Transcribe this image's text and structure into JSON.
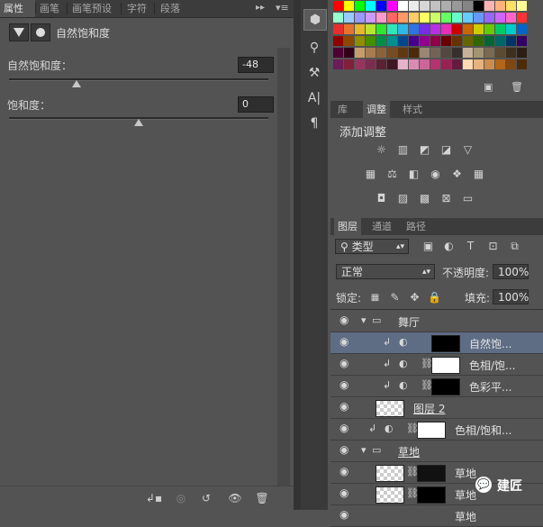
{
  "properties_panel": {
    "tabs": [
      "属性",
      "画笔",
      "画笔预设",
      "字符",
      "段落"
    ],
    "title": "自然饱和度",
    "vibrance_label": "自然饱和度：",
    "vibrance_value": "-48",
    "vibrance_fraction": 0.26,
    "saturation_label": "饱和度：",
    "saturation_value": "0",
    "saturation_fraction": 0.5
  },
  "swatches_colors": [
    [
      "#ff0000",
      "#ffff00",
      "#00ff00",
      "#00ffff",
      "#0000ff",
      "#ff00ff",
      "#ffffff",
      "#ebebeb",
      "#d6d6d6",
      "#c2c2c2",
      "#adadad",
      "#999999",
      "#858585",
      "#000000",
      "#ffb3b3",
      "#ffb37a",
      "#ffe066",
      "#ffff99"
    ],
    [
      "#99ffcc",
      "#99ccff",
      "#9999ff",
      "#cc99ff",
      "#ff99cc",
      "#ff6666",
      "#ff9966",
      "#ffcc66",
      "#ffff66",
      "#ccff66",
      "#66ff66",
      "#66ffcc",
      "#66ccff",
      "#6699ff",
      "#9966ff",
      "#cc66ff",
      "#ff66cc",
      "#ff3333"
    ],
    [
      "#e62e2e",
      "#e6732e",
      "#e6b82e",
      "#b8e62e",
      "#2ee62e",
      "#2ee6b8",
      "#2eb8e6",
      "#2e73e6",
      "#732ee6",
      "#b82ee6",
      "#e62eb8",
      "#cc0000",
      "#cc6600",
      "#cccc00",
      "#66cc00",
      "#00cc66",
      "#00cccc",
      "#0066cc"
    ],
    [
      "#8e0000",
      "#8e4700",
      "#8e8e00",
      "#478e00",
      "#008e47",
      "#008e8e",
      "#00478e",
      "#47008e",
      "#8e008e",
      "#8e0047",
      "#660000",
      "#663300",
      "#666600",
      "#336600",
      "#006633",
      "#006666",
      "#003366",
      "#330066"
    ],
    [
      "#4d0033",
      "#33001a",
      "#c69c6d",
      "#a67c52",
      "#8c6239",
      "#754c24",
      "#603913",
      "#4a2a0a",
      "#998675",
      "#736357",
      "#534741",
      "#362f2d",
      "#c7b299",
      "#a19574",
      "#7a6a4f",
      "#5c4a33",
      "#3d2f1e",
      "#2b1f14"
    ],
    [
      "#6b1d57",
      "#80203a",
      "#99345f",
      "#7a2e4f",
      "#5c2233",
      "#3f1724",
      "#e6b3cc",
      "#d98cb3",
      "#cc6699",
      "#b3336e",
      "#992255",
      "#661a40",
      "#ffd9b3",
      "#e6b380",
      "#cc8c4d",
      "#b3661a",
      "#804812",
      "#4d2b0b"
    ]
  ],
  "adjustments_panel": {
    "tabs": [
      "库",
      "调整",
      "样式"
    ],
    "title": "添加调整"
  },
  "layers_panel": {
    "tabs": [
      "图层",
      "通道",
      "路径"
    ],
    "filter_kind": "类型",
    "blend_mode": "正常",
    "opacity_label": "不透明度:",
    "opacity_value": "100%",
    "lock_label": "锁定:",
    "fill_label": "填充:",
    "fill_value": "100%",
    "layers": [
      {
        "name": "舞厅"
      },
      {
        "name": "自然饱..."
      },
      {
        "name": "色相/饱..."
      },
      {
        "name": "色彩平..."
      },
      {
        "name": "图层 2"
      },
      {
        "name": "色相/饱和..."
      },
      {
        "name": "草地"
      },
      {
        "name": "草地"
      },
      {
        "name": "草地"
      },
      {
        "name": "草地"
      }
    ]
  },
  "watermark": {
    "text": "建匠"
  },
  "icons": {
    "filter_kind": "search-icon",
    "eye": "eye-icon",
    "folder": "folder-icon",
    "chain": "chain-link-icon",
    "clip": "clip-arrow-icon"
  }
}
